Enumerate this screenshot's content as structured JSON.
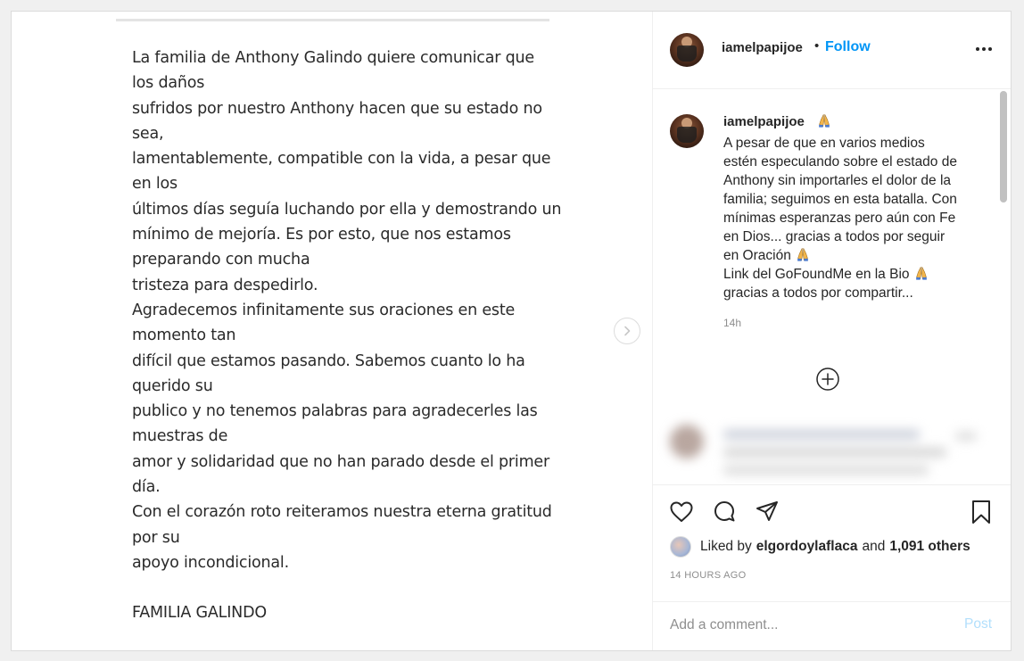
{
  "post": {
    "statement_lines": [
      "La familia de Anthony Galindo quiere comunicar que",
      "los daños",
      "sufridos por nuestro Anthony hacen que su estado no",
      "sea,",
      "lamentablemente, compatible con la vida, a pesar que",
      "en los",
      "últimos días seguía luchando por ella y demostrando un",
      "mínimo de mejoría.  Es por esto, que nos estamos",
      "preparando con mucha",
      "tristeza para despedirlo.",
      "Agradecemos infinitamente sus oraciones en este",
      "momento tan",
      "difícil que estamos pasando. Sabemos cuanto lo ha",
      "querido su",
      "publico y no tenemos palabras para agradecerles las",
      "muestras de",
      "amor y solidaridad que no han parado desde el primer",
      "día.",
      "Con el corazón roto reiteramos nuestra eterna gratitud",
      "por su",
      "apoyo incondicional."
    ],
    "signoff": "FAMILIA GALINDO"
  },
  "header": {
    "username": "iamelpapijoe",
    "separator": "•",
    "follow_label": "Follow",
    "more_icon": "more-horizontal-icon"
  },
  "caption": {
    "username": "iamelpapijoe",
    "lines": [
      "A pesar de que en varios medios",
      "estén especulando sobre el estado de",
      "Anthony sin importarles el dolor de la",
      "familia; seguimos en esta batalla. Con",
      "mínimas esperanzas pero aún con Fe",
      "en Dios... gracias a todos por seguir",
      "en Oración",
      "Link del GoFoundMe en la Bio",
      "gracias a todos por compartir..."
    ],
    "time": "14h",
    "emoji_icon": "folded-hands-icon"
  },
  "actions": {
    "like_icon": "heart-icon",
    "comment_icon": "comment-icon",
    "share_icon": "paper-plane-icon",
    "save_icon": "bookmark-icon",
    "liked_by_prefix": "Liked by",
    "liked_by_user": "elgordoylaflaca",
    "and_text": "and",
    "others_text": "1,091 others",
    "timestamp": "14 HOURS AGO"
  },
  "comment_box": {
    "placeholder": "Add a comment...",
    "post_label": "Post"
  },
  "colors": {
    "accent": "#0095f6",
    "post_disabled": "#b2dffc",
    "text": "#262626",
    "muted": "#8e8e8e"
  }
}
